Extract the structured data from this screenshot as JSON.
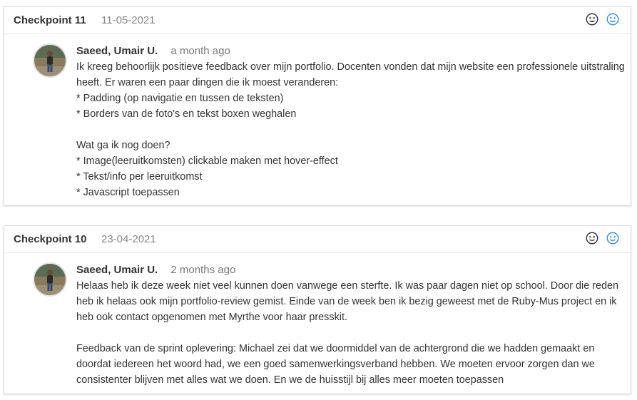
{
  "colors": {
    "accent_smiley": "#3d8fd6",
    "neutral_smiley": "#333333",
    "border": "#d9d9d9"
  },
  "entries": [
    {
      "title": "Checkpoint 11",
      "date": "11-05-2021",
      "author": "Saeed, Umair U.",
      "time_ago": "a month ago",
      "text": "Ik kreeg behoorlijk positieve feedback over mijn portfolio. Docenten vonden dat mijn website een professionele uitstraling heeft. Er waren een paar dingen die ik moest veranderen:\n* Padding (op navigatie en tussen de teksten)\n* Borders van de foto's en tekst boxen weghalen\n\nWat ga ik nog doen?\n* Image(leeruitkomsten) clickable maken met hover-effect\n* Tekst/info per leeruitkomst\n* Javascript toepassen",
      "icons": [
        "neutral-face-icon",
        "smiley-face-icon"
      ]
    },
    {
      "title": "Checkpoint 10",
      "date": "23-04-2021",
      "author": "Saeed, Umair U.",
      "time_ago": "2 months ago",
      "text": "Helaas heb ik deze week niet veel kunnen doen vanwege een sterfte. Ik was paar dagen niet op school. Door die reden heb ik helaas ook mijn portfolio-review gemist. Einde van de week ben ik bezig geweest met de Ruby-Mus project en ik heb ook contact opgenomen met Myrthe voor haar presskit.\n\nFeedback van de sprint oplevering: Michael zei dat we doormiddel van de achtergrond die we hadden gemaakt en doordat iedereen het woord had, we een goed samenwerkingsverband hebben. We moeten ervoor zorgen dan we consistenter blijven met alles wat we doen. En we de huisstijl bij alles meer moeten toepassen",
      "icons": [
        "neutral-face-icon",
        "smiley-face-icon"
      ]
    }
  ]
}
